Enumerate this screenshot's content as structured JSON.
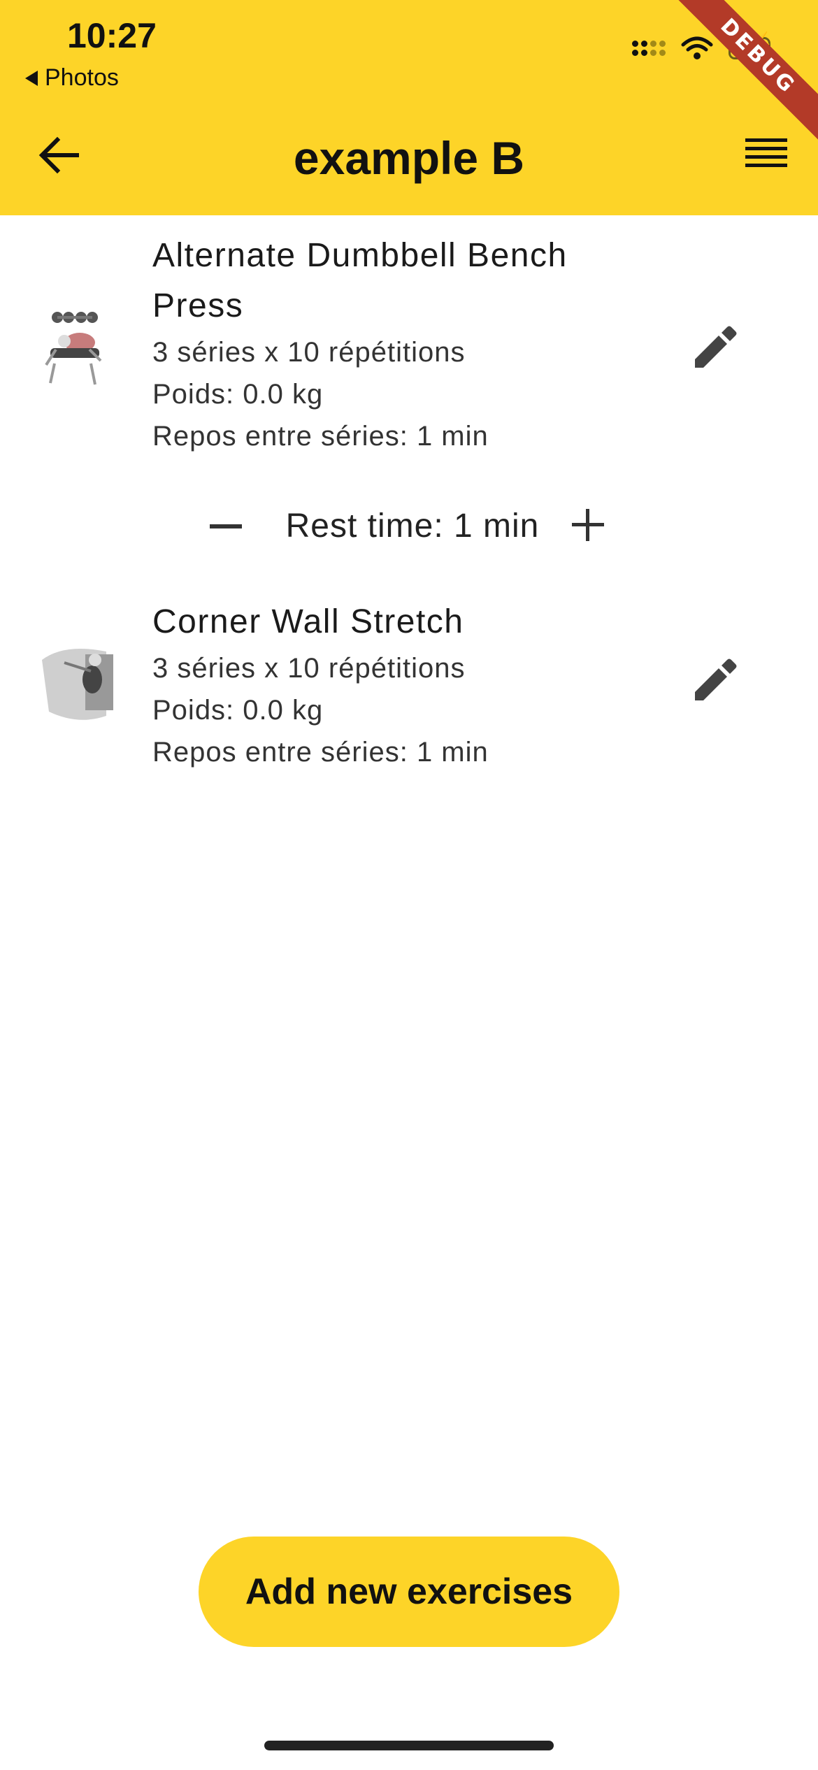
{
  "status_bar": {
    "time": "10:27",
    "back_app_label": "Photos",
    "debug_label": "DEBUG"
  },
  "header": {
    "title": "example B",
    "back_icon": "arrow-left-icon",
    "menu_icon": "list-icon"
  },
  "exercises": [
    {
      "name_line1": "Alternate Dumbbell Bench",
      "name_line2": "Press",
      "sets": "3 séries x 10 répétitions",
      "weight": "Poids: 0.0 kg",
      "rest": "Repos entre séries: 1 min"
    },
    {
      "name_line1": "Corner Wall Stretch",
      "sets": "3 séries x 10 répétitions",
      "weight": "Poids: 0.0 kg",
      "rest": "Repos entre séries: 1 min"
    }
  ],
  "rest_control": {
    "label": "Rest time: 1 min"
  },
  "footer": {
    "add_button_label": "Add new exercises"
  },
  "colors": {
    "accent": "#fdd428",
    "debug_ribbon": "#b33a28"
  }
}
